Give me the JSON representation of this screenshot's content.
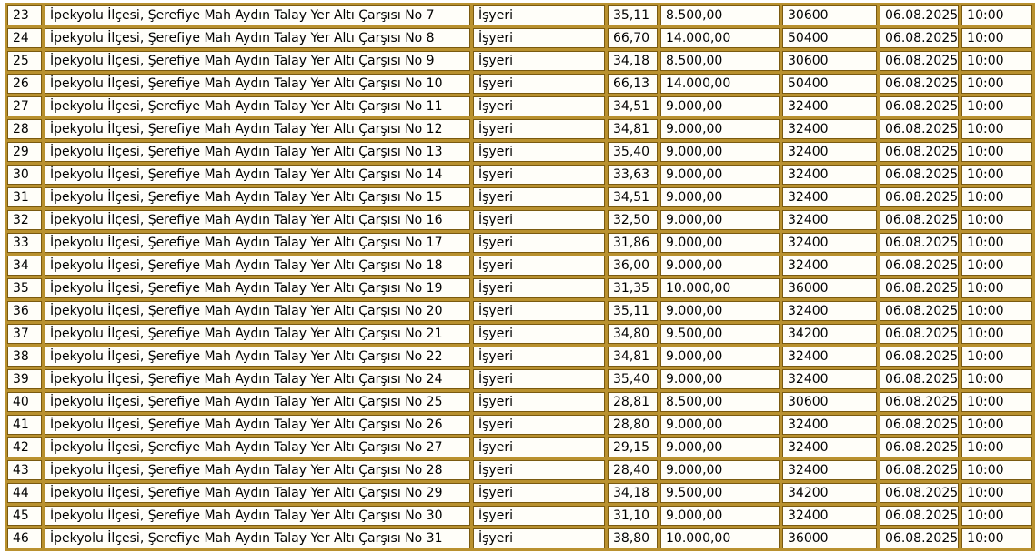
{
  "rows": [
    {
      "no": "23",
      "address": "İpekyolu İlçesi, Şerefiye Mah Aydın Talay Yer Altı Çarşısı No 7",
      "type": "İşyeri",
      "area": "35,11",
      "price": "8.500,00",
      "deposit": "30600",
      "date": "06.08.2025",
      "time": "10:00"
    },
    {
      "no": "24",
      "address": "İpekyolu İlçesi, Şerefiye Mah Aydın Talay Yer Altı Çarşısı No 8",
      "type": "İşyeri",
      "area": "66,70",
      "price": "14.000,00",
      "deposit": "50400",
      "date": "06.08.2025",
      "time": "10:00"
    },
    {
      "no": "25",
      "address": "İpekyolu İlçesi, Şerefiye Mah Aydın Talay Yer Altı Çarşısı No 9",
      "type": "İşyeri",
      "area": "34,18",
      "price": "8.500,00",
      "deposit": "30600",
      "date": "06.08.2025",
      "time": "10:00"
    },
    {
      "no": "26",
      "address": "İpekyolu İlçesi, Şerefiye Mah Aydın Talay Yer Altı Çarşısı No 10",
      "type": "İşyeri",
      "area": "66,13",
      "price": "14.000,00",
      "deposit": "50400",
      "date": "06.08.2025",
      "time": "10:00"
    },
    {
      "no": "27",
      "address": "İpekyolu İlçesi, Şerefiye Mah Aydın Talay Yer Altı Çarşısı No 11",
      "type": "İşyeri",
      "area": "34,51",
      "price": "9.000,00",
      "deposit": "32400",
      "date": "06.08.2025",
      "time": "10:00"
    },
    {
      "no": "28",
      "address": "İpekyolu İlçesi, Şerefiye Mah Aydın Talay Yer Altı Çarşısı No 12",
      "type": "İşyeri",
      "area": "34,81",
      "price": "9.000,00",
      "deposit": "32400",
      "date": "06.08.2025",
      "time": "10:00"
    },
    {
      "no": "29",
      "address": "İpekyolu İlçesi, Şerefiye Mah Aydın Talay Yer Altı Çarşısı No 13",
      "type": "İşyeri",
      "area": "35,40",
      "price": "9.000,00",
      "deposit": "32400",
      "date": "06.08.2025",
      "time": "10:00"
    },
    {
      "no": "30",
      "address": "İpekyolu İlçesi, Şerefiye Mah Aydın Talay Yer Altı Çarşısı No 14",
      "type": "İşyeri",
      "area": "33,63",
      "price": "9.000,00",
      "deposit": "32400",
      "date": "06.08.2025",
      "time": "10:00"
    },
    {
      "no": "31",
      "address": "İpekyolu İlçesi, Şerefiye Mah Aydın Talay Yer Altı Çarşısı No 15",
      "type": "İşyeri",
      "area": "34,51",
      "price": "9.000,00",
      "deposit": "32400",
      "date": "06.08.2025",
      "time": "10:00"
    },
    {
      "no": "32",
      "address": "İpekyolu İlçesi, Şerefiye Mah Aydın Talay Yer Altı Çarşısı No 16",
      "type": "İşyeri",
      "area": "32,50",
      "price": "9.000,00",
      "deposit": "32400",
      "date": "06.08.2025",
      "time": "10:00"
    },
    {
      "no": "33",
      "address": "İpekyolu İlçesi, Şerefiye Mah Aydın Talay Yer Altı Çarşısı No 17",
      "type": "İşyeri",
      "area": "31,86",
      "price": "9.000,00",
      "deposit": "32400",
      "date": "06.08.2025",
      "time": "10:00"
    },
    {
      "no": "34",
      "address": "İpekyolu İlçesi, Şerefiye Mah Aydın Talay Yer Altı Çarşısı No 18",
      "type": "İşyeri",
      "area": "36,00",
      "price": "9.000,00",
      "deposit": "32400",
      "date": "06.08.2025",
      "time": "10:00"
    },
    {
      "no": "35",
      "address": "İpekyolu İlçesi, Şerefiye Mah Aydın Talay Yer Altı Çarşısı No 19",
      "type": "İşyeri",
      "area": "31,35",
      "price": "10.000,00",
      "deposit": "36000",
      "date": "06.08.2025",
      "time": "10:00"
    },
    {
      "no": "36",
      "address": "İpekyolu İlçesi, Şerefiye Mah Aydın Talay Yer Altı Çarşısı No 20",
      "type": "İşyeri",
      "area": "35,11",
      "price": "9.000,00",
      "deposit": "32400",
      "date": "06.08.2025",
      "time": "10:00"
    },
    {
      "no": "37",
      "address": "İpekyolu İlçesi, Şerefiye Mah Aydın Talay Yer Altı Çarşısı No 21",
      "type": "İşyeri",
      "area": "34,80",
      "price": "9.500,00",
      "deposit": "34200",
      "date": "06.08.2025",
      "time": "10:00"
    },
    {
      "no": "38",
      "address": "İpekyolu İlçesi, Şerefiye Mah Aydın Talay Yer Altı Çarşısı No 22",
      "type": "İşyeri",
      "area": "34,81",
      "price": "9.000,00",
      "deposit": "32400",
      "date": "06.08.2025",
      "time": "10:00"
    },
    {
      "no": "39",
      "address": "İpekyolu İlçesi, Şerefiye Mah Aydın Talay Yer Altı Çarşısı No 24",
      "type": "İşyeri",
      "area": "35,40",
      "price": "9.000,00",
      "deposit": "32400",
      "date": "06.08.2025",
      "time": "10:00"
    },
    {
      "no": "40",
      "address": "İpekyolu İlçesi, Şerefiye Mah Aydın Talay Yer Altı Çarşısı No 25",
      "type": "İşyeri",
      "area": "28,81",
      "price": "8.500,00",
      "deposit": "30600",
      "date": "06.08.2025",
      "time": "10:00"
    },
    {
      "no": "41",
      "address": "İpekyolu İlçesi, Şerefiye Mah Aydın Talay Yer Altı Çarşısı No 26",
      "type": "İşyeri",
      "area": "28,80",
      "price": "9.000,00",
      "deposit": "32400",
      "date": "06.08.2025",
      "time": "10:00"
    },
    {
      "no": "42",
      "address": "İpekyolu İlçesi, Şerefiye Mah Aydın Talay Yer Altı Çarşısı No 27",
      "type": "İşyeri",
      "area": "29,15",
      "price": "9.000,00",
      "deposit": "32400",
      "date": "06.08.2025",
      "time": "10:00"
    },
    {
      "no": "43",
      "address": "İpekyolu İlçesi, Şerefiye Mah Aydın Talay Yer Altı Çarşısı No 28",
      "type": "İşyeri",
      "area": "28,40",
      "price": "9.000,00",
      "deposit": "32400",
      "date": "06.08.2025",
      "time": "10:00"
    },
    {
      "no": "44",
      "address": "İpekyolu İlçesi, Şerefiye Mah Aydın Talay Yer Altı Çarşısı No 29",
      "type": "İşyeri",
      "area": "34,18",
      "price": "9.500,00",
      "deposit": "34200",
      "date": "06.08.2025",
      "time": "10:00"
    },
    {
      "no": "45",
      "address": "İpekyolu İlçesi, Şerefiye Mah Aydın Talay Yer Altı Çarşısı No 30",
      "type": "İşyeri",
      "area": "31,10",
      "price": "9.000,00",
      "deposit": "32400",
      "date": "06.08.2025",
      "time": "10:00"
    },
    {
      "no": "46",
      "address": "İpekyolu İlçesi, Şerefiye Mah Aydın Talay Yer Altı Çarşısı No 31",
      "type": "İşyeri",
      "area": "38,80",
      "price": "10.000,00",
      "deposit": "36000",
      "date": "06.08.2025",
      "time": "10:00"
    }
  ],
  "colors": {
    "grid_gold": "#b9912f",
    "cell_border": "#7a5a10",
    "cell_bg": "#fffef9",
    "text": "#000000"
  }
}
